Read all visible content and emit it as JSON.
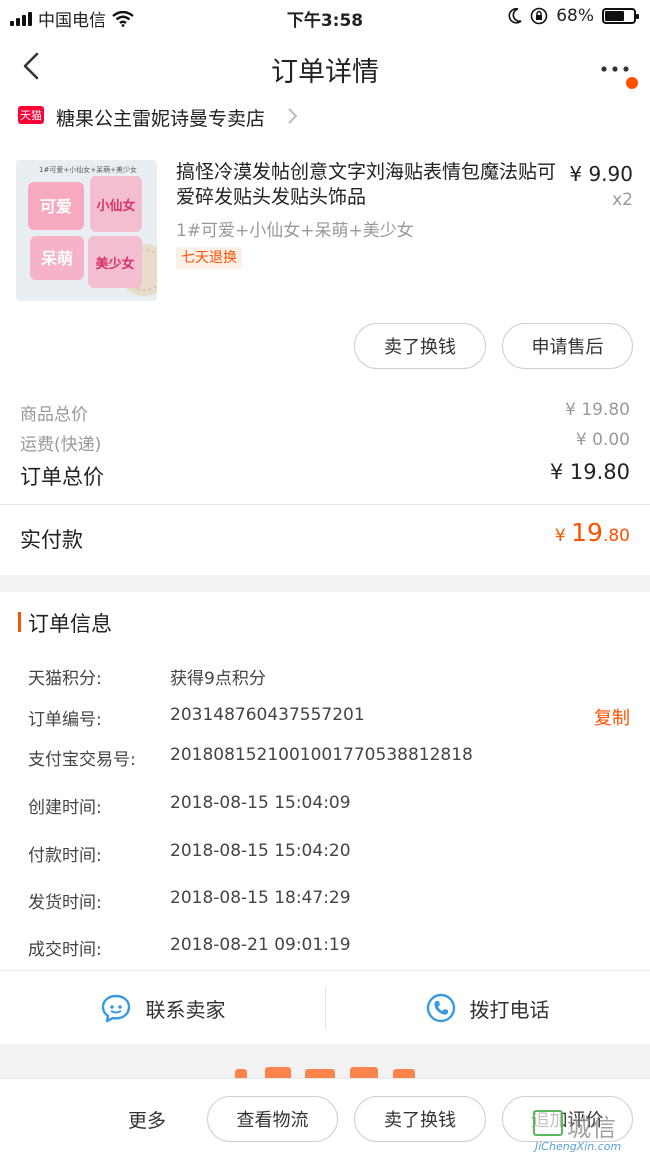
{
  "status_bar": {
    "carrier": "中国电信",
    "time": "下午3:58",
    "battery_pct_text": "68%",
    "battery_level": 0.68
  },
  "nav": {
    "title": "订单详情"
  },
  "store": {
    "badge": "天猫",
    "name": "糖果公主雷妮诗曼专卖店"
  },
  "product": {
    "title": "搞怪冷漠发帖创意文字刘海贴表情包魔法贴可爱碎发贴头发贴头饰品",
    "price": "¥ 9.90",
    "qty": "x2",
    "sku": "1#可爱+小仙女+呆萌+美少女",
    "return_tag": "七天退换",
    "image": {
      "caption": "1#可爱+小仙女+呆萌+美少女",
      "tile_texts": [
        "可爱",
        "小仙女",
        "呆萌",
        "美少女"
      ]
    },
    "actions": {
      "sell": "卖了换钱",
      "aftersale": "申请售后"
    }
  },
  "fees": {
    "goods_label": "商品总价",
    "goods_value": "¥ 19.80",
    "shipping_label": "运费(快递)",
    "shipping_value": "¥ 0.00",
    "total_label": "订单总价",
    "total_value": "¥ 19.80",
    "paid_label": "实付款",
    "paid_currency": "¥ ",
    "paid_int": "19",
    "paid_dec": ".80"
  },
  "order_info": {
    "title": "订单信息",
    "rows": [
      {
        "label": "天猫积分:",
        "value": "获得9点积分"
      },
      {
        "label": "订单编号:",
        "value": "203148760437557201"
      },
      {
        "label": "支付宝交易号:",
        "value": "2018081521001001770538812818"
      },
      {
        "label": "创建时间:",
        "value": "2018-08-15 15:04:09"
      },
      {
        "label": "付款时间:",
        "value": "2018-08-15 15:04:20"
      },
      {
        "label": "发货时间:",
        "value": "2018-08-15 18:47:29"
      },
      {
        "label": "成交时间:",
        "value": "2018-08-21 09:01:19"
      }
    ],
    "copy": "复制"
  },
  "contact": {
    "seller": "联系卖家",
    "phone": "拨打电话"
  },
  "bottom_bar": {
    "more": "更多",
    "logistics": "查看物流",
    "sell": "卖了换钱",
    "review": "追加评价"
  },
  "watermark": {
    "text": "城信",
    "sub": "JiChengXin.com"
  },
  "colors": {
    "accent": "#ff5000",
    "tmall_red": "#ff0036",
    "link_blue": "#3a9ae0"
  }
}
